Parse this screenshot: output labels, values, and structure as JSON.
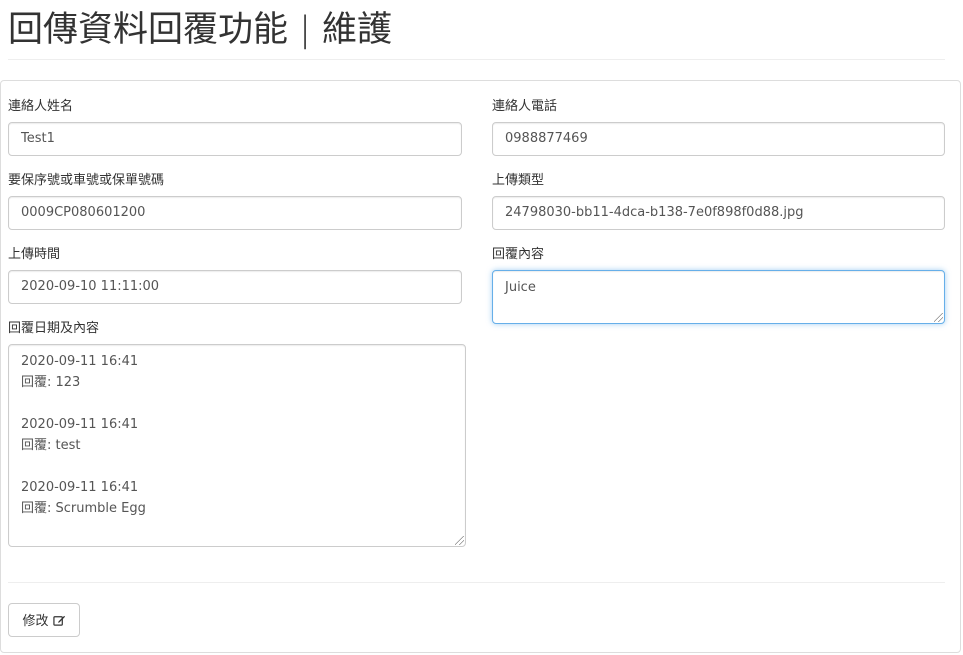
{
  "page": {
    "title": "回傳資料回覆功能 | 維護"
  },
  "form": {
    "contact_name": {
      "label": "連絡人姓名",
      "value": "Test1"
    },
    "contact_phone": {
      "label": "連絡人電話",
      "value": "0988877469"
    },
    "policy_number": {
      "label": "要保序號或車號或保單號碼",
      "value": "0009CP080601200"
    },
    "upload_type": {
      "label": "上傳類型",
      "value": "24798030-bb11-4dca-b138-7e0f898f0d88.jpg"
    },
    "upload_time": {
      "label": "上傳時間",
      "value": "2020-09-10 11:11:00"
    },
    "reply_content": {
      "label": "回覆內容",
      "value": "Juice"
    },
    "reply_history": {
      "label": "回覆日期及內容",
      "entries": [
        {
          "date": "2020-09-11 16:41",
          "text": "回覆: 123"
        },
        {
          "date": "2020-09-11 16:41",
          "text": "回覆: test"
        },
        {
          "date": "2020-09-11 16:41",
          "text": "回覆: Scrumble Egg"
        }
      ]
    }
  },
  "actions": {
    "edit_label": "修改",
    "edit_icon": "edit-icon"
  },
  "colors": {
    "focus_border": "#66afe9",
    "input_border": "#cccccc",
    "text": "#333333"
  }
}
